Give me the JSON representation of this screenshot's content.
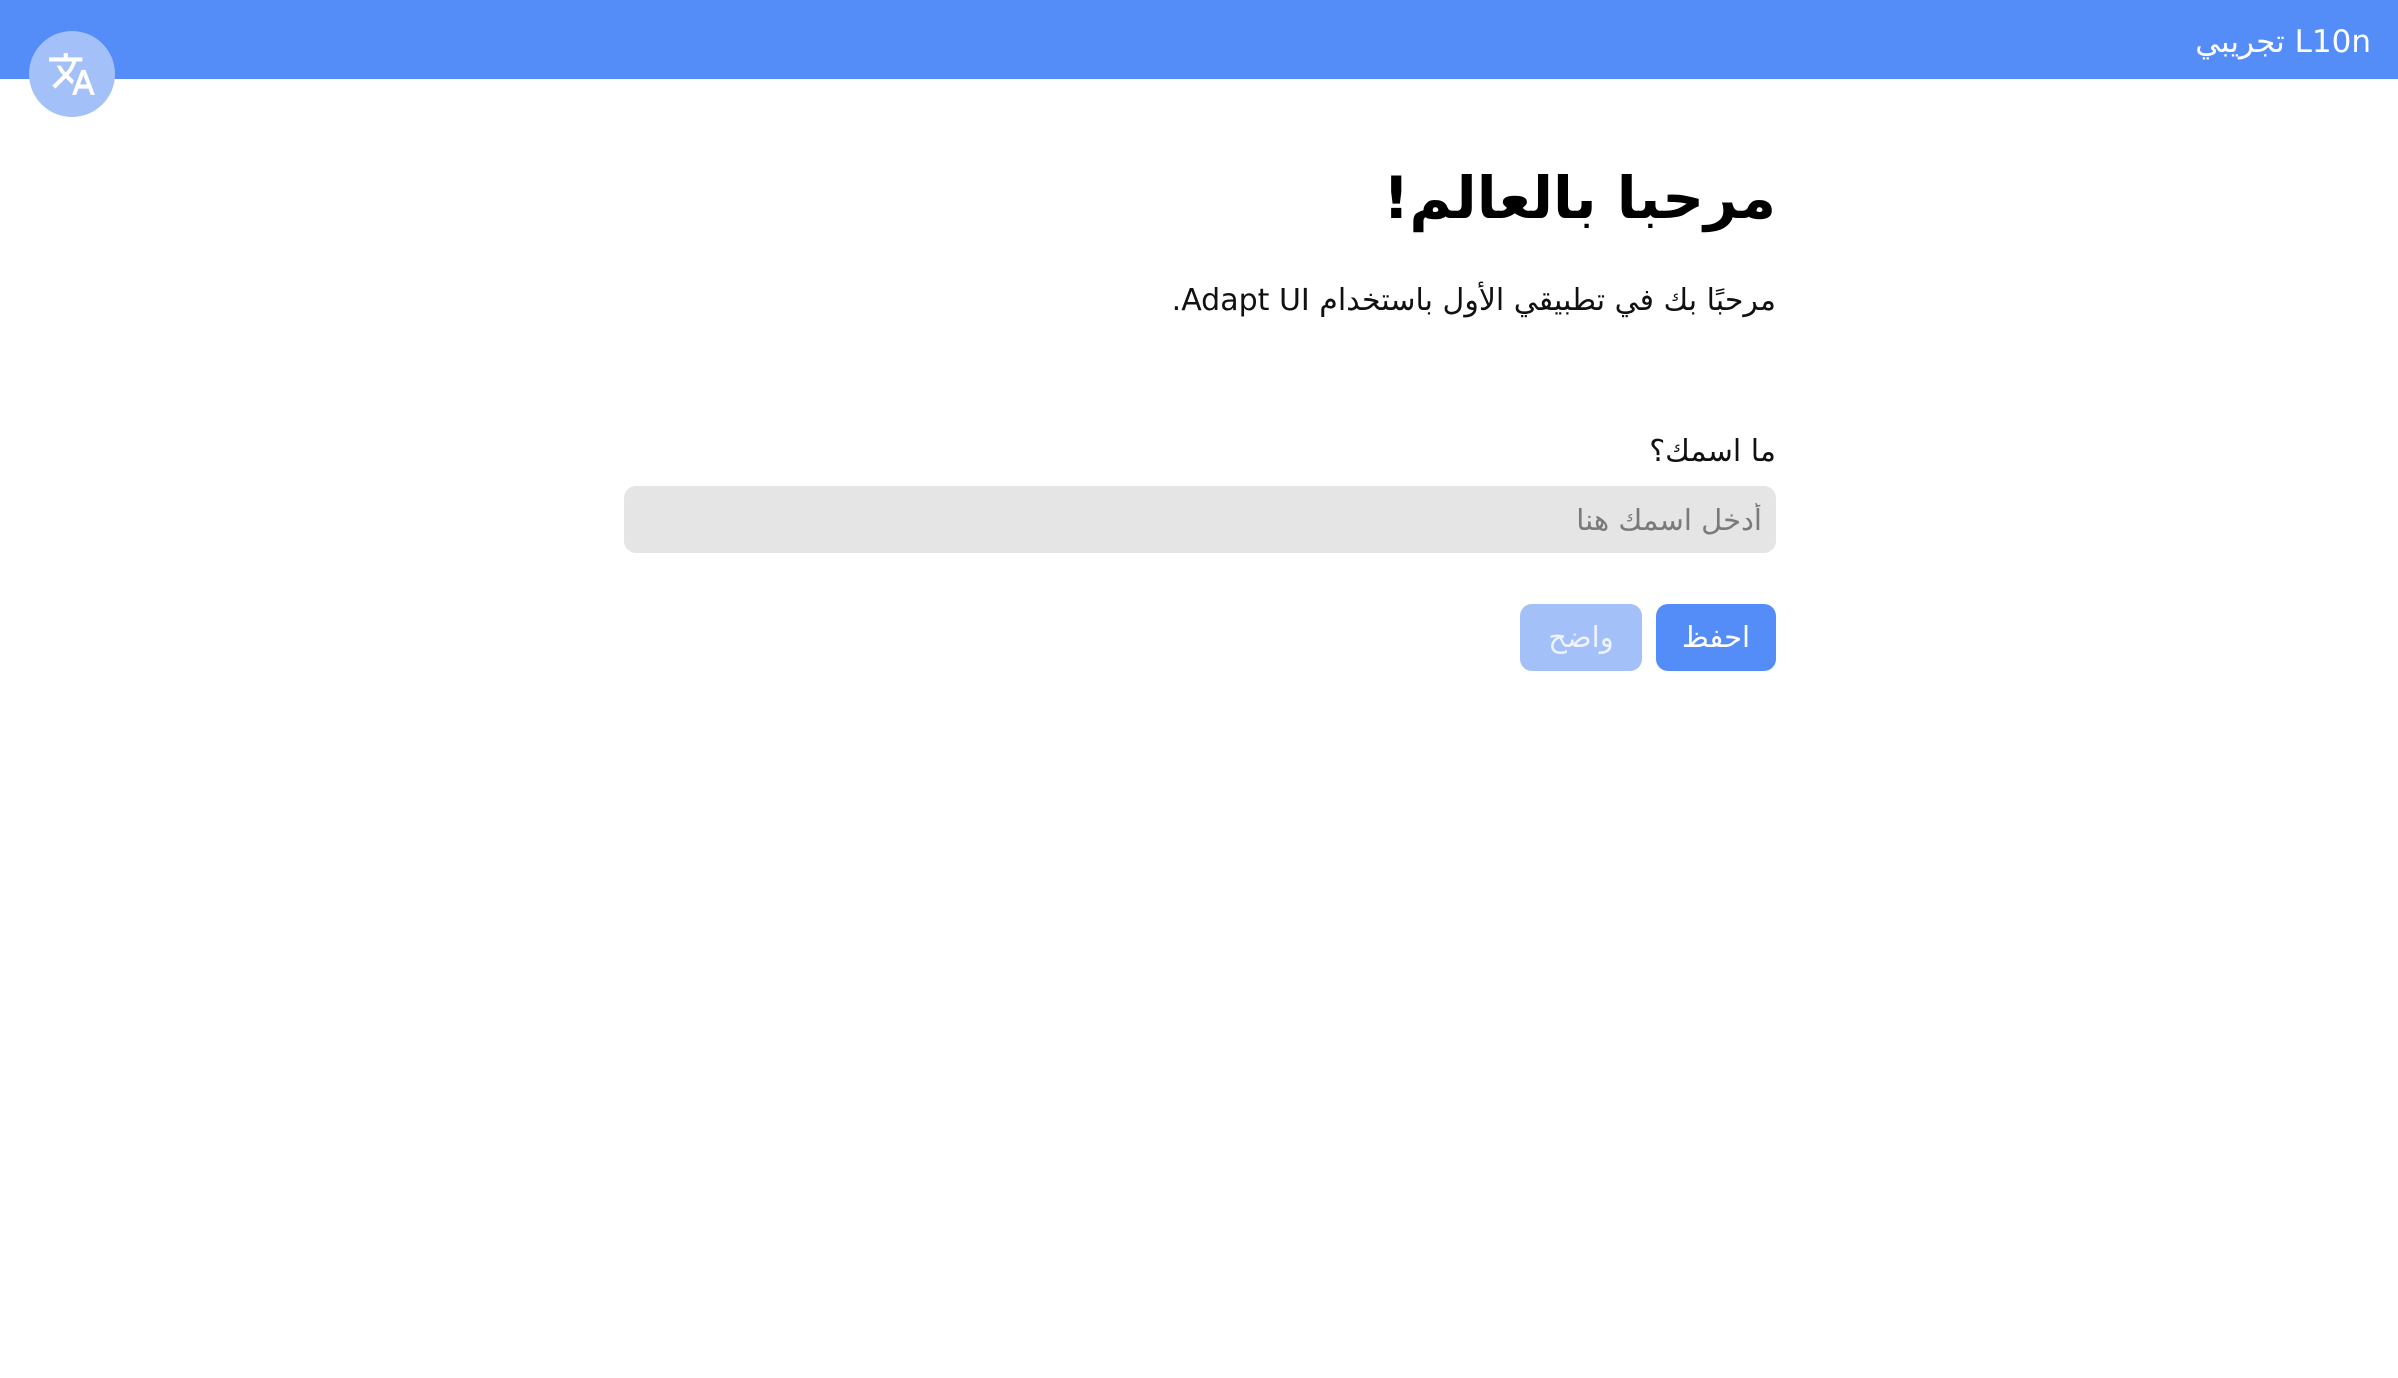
{
  "header": {
    "title": "L10n تجريبي",
    "bar_color": "#558df8"
  },
  "language_button": {
    "icon": "translate-icon",
    "color": "#a4c0f9"
  },
  "main": {
    "title": "مرحبا بالعالم!",
    "intro": "مرحبًا بك في تطبيقي الأول باستخدام Adapt UI.",
    "name_label": "ما اسمك؟",
    "name_input": {
      "value": "",
      "placeholder": "أدخل اسمك هنا"
    },
    "buttons": {
      "save_label": "احفظ",
      "clear_label": "واضح"
    }
  },
  "colors": {
    "accent": "#558df8",
    "accent_light": "#a4c0f9",
    "input_bg": "#e5e5e5"
  }
}
